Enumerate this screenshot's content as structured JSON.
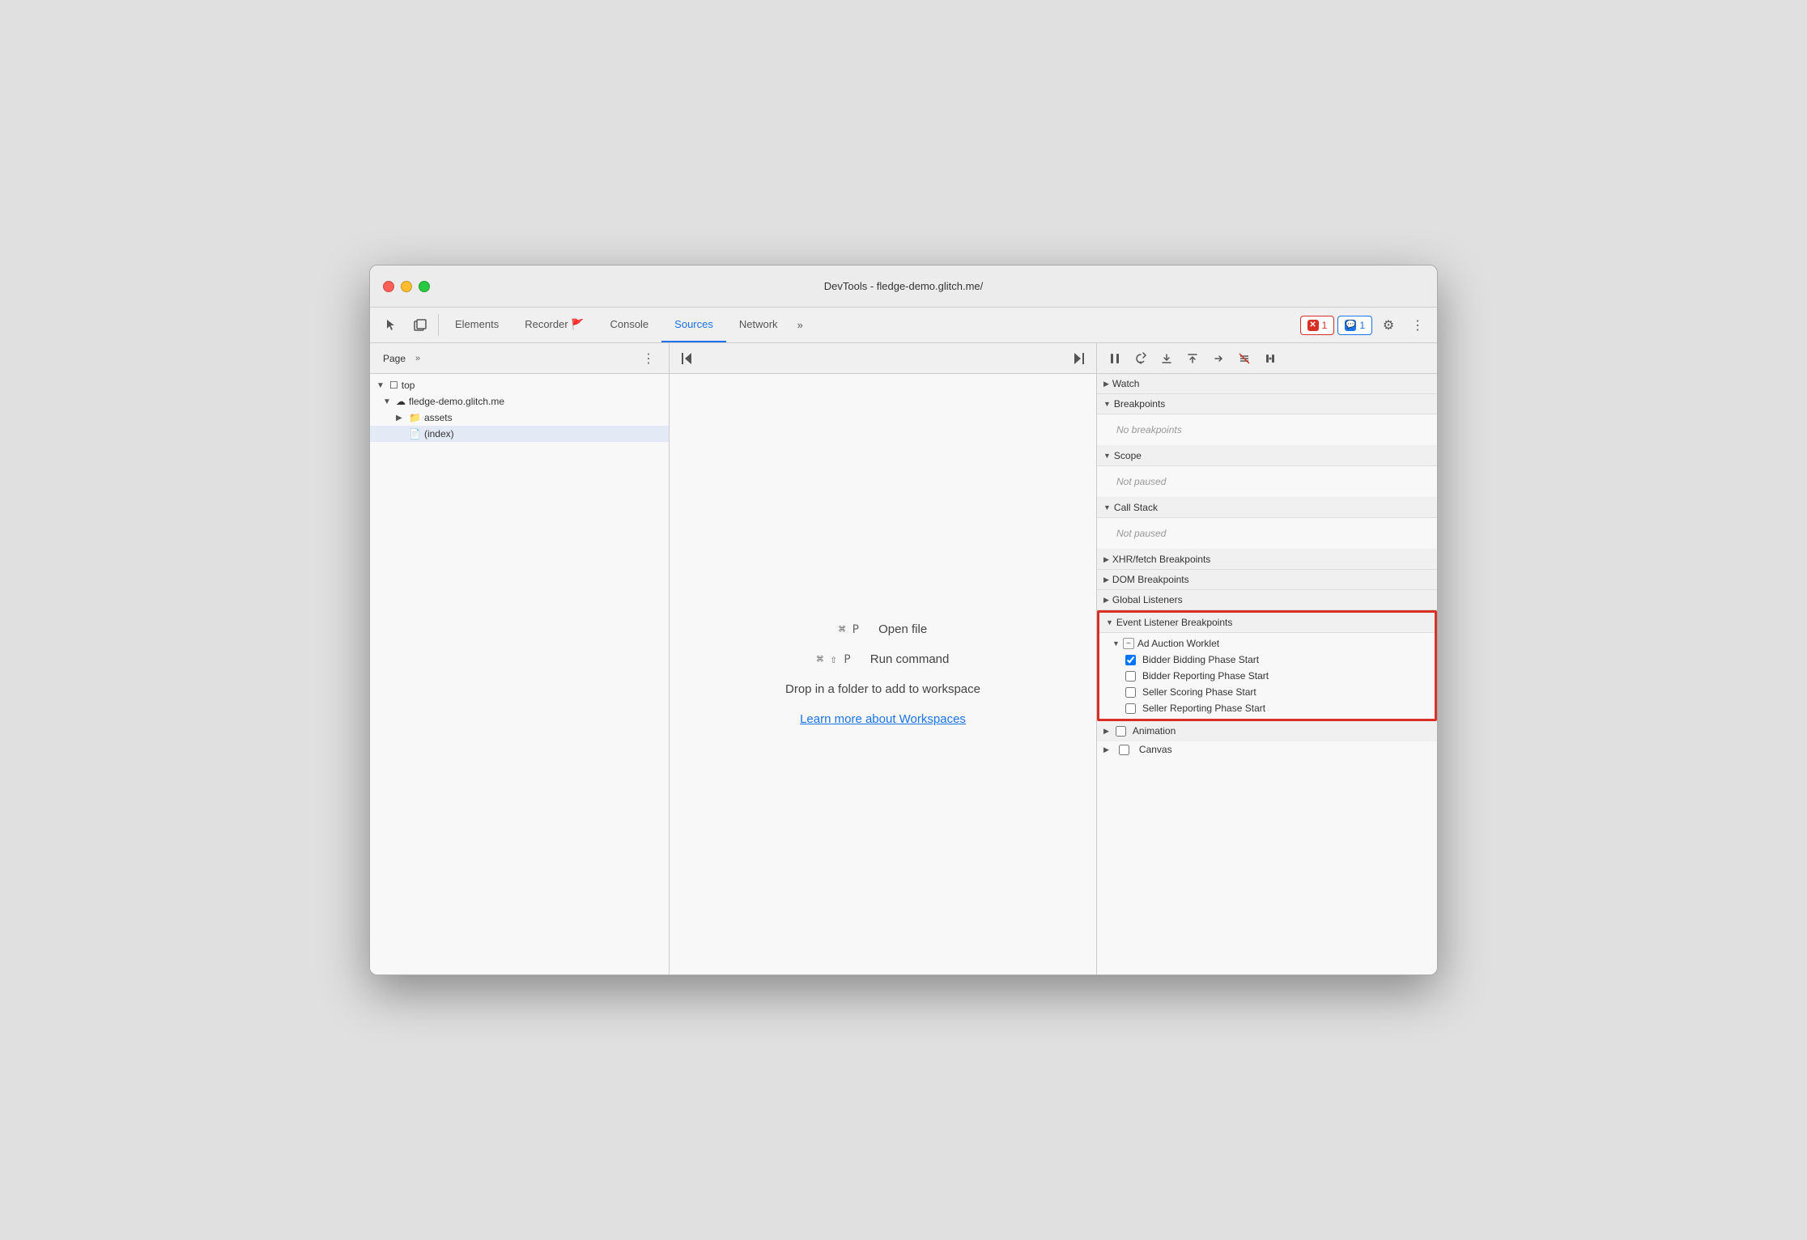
{
  "window": {
    "title": "DevTools - fledge-demo.glitch.me/"
  },
  "tabs": {
    "icons": [
      "cursor",
      "duplicate"
    ],
    "items": [
      {
        "label": "Elements",
        "active": false
      },
      {
        "label": "Recorder 🚩",
        "active": false
      },
      {
        "label": "Console",
        "active": false
      },
      {
        "label": "Sources",
        "active": true
      },
      {
        "label": "Network",
        "active": false
      }
    ],
    "overflow": "»",
    "error_badge": "1",
    "info_badge": "1",
    "gear_icon": "⚙",
    "more_icon": "⋮"
  },
  "left_panel": {
    "tab_label": "Page",
    "chevron": "»",
    "more_dots": "⋮",
    "tree": [
      {
        "label": "top",
        "indent": 0,
        "arrow": "▼",
        "icon": "☐",
        "type": "folder"
      },
      {
        "label": "fledge-demo.glitch.me",
        "indent": 1,
        "arrow": "▼",
        "icon": "☁",
        "type": "domain"
      },
      {
        "label": "assets",
        "indent": 2,
        "arrow": "▶",
        "icon": "📁",
        "type": "folder"
      },
      {
        "label": "(index)",
        "indent": 2,
        "arrow": "",
        "icon": "📄",
        "type": "file",
        "selected": true
      }
    ]
  },
  "middle_panel": {
    "left_nav_icon": "◀|",
    "right_nav_icon": "|▶",
    "shortcut1": {
      "key": "⌘ P",
      "label": "Open file"
    },
    "shortcut2": {
      "key": "⌘ ⇧ P",
      "label": "Run command"
    },
    "drop_text": "Drop in a folder to add to workspace",
    "workspace_link": "Learn more about Workspaces"
  },
  "right_panel": {
    "debug_buttons": [
      "pause",
      "step-over",
      "step-into",
      "step-out",
      "step",
      "deactivate",
      "pause-async"
    ],
    "sections": [
      {
        "id": "watch",
        "label": "Watch",
        "arrow": "▶",
        "collapsed": true
      },
      {
        "id": "breakpoints",
        "label": "Breakpoints",
        "arrow": "▼",
        "collapsed": false,
        "empty_text": "No breakpoints"
      },
      {
        "id": "scope",
        "label": "Scope",
        "arrow": "▼",
        "collapsed": false,
        "empty_text": "Not paused"
      },
      {
        "id": "call-stack",
        "label": "Call Stack",
        "arrow": "▼",
        "collapsed": false,
        "empty_text": "Not paused"
      },
      {
        "id": "xhr",
        "label": "XHR/fetch Breakpoints",
        "arrow": "▶",
        "collapsed": true
      },
      {
        "id": "dom",
        "label": "DOM Breakpoints",
        "arrow": "▶",
        "collapsed": true
      },
      {
        "id": "global",
        "label": "Global Listeners",
        "arrow": "▶",
        "collapsed": true
      }
    ],
    "event_listener_section": {
      "label": "Event Listener Breakpoints",
      "arrow": "▼",
      "group": {
        "label": "Ad Auction Worklet",
        "items": [
          {
            "label": "Bidder Bidding Phase Start",
            "checked": true
          },
          {
            "label": "Bidder Reporting Phase Start",
            "checked": false
          },
          {
            "label": "Seller Scoring Phase Start",
            "checked": false
          },
          {
            "label": "Seller Reporting Phase Start",
            "checked": false
          }
        ]
      }
    },
    "animation_section": {
      "label": "Animation",
      "arrow": "▶",
      "collapsed": true
    },
    "canvas_section": {
      "label": "Canvas",
      "partial": true
    }
  }
}
